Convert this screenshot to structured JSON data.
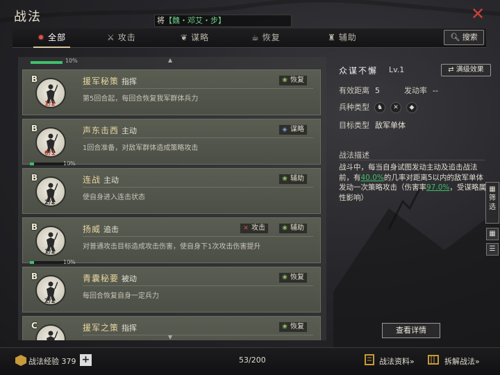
{
  "header": {
    "title": "战法",
    "general_prefix": "将",
    "general_name": "【魏・邓艾・步】",
    "close_icon": "close-icon"
  },
  "tabs": [
    {
      "label": "全部",
      "icon": "all-icon",
      "active": true
    },
    {
      "label": "攻击",
      "icon": "swords-icon",
      "active": false
    },
    {
      "label": "谋略",
      "icon": "scheme-icon",
      "active": false
    },
    {
      "label": "恢复",
      "icon": "teapot-icon",
      "active": false
    },
    {
      "label": "辅助",
      "icon": "bag-icon",
      "active": false
    }
  ],
  "search_label": "搜索",
  "list": {
    "top_progress": "10%",
    "cards": [
      {
        "grade": "B",
        "name": "援军秘策",
        "kind": "指挥",
        "desc": "第5回合起，每回合恢复我军群体兵力",
        "stack": "1/2",
        "stack_red": true,
        "badges": [
          {
            "label": "恢复",
            "type": "g"
          }
        ],
        "progress": null
      },
      {
        "grade": "B",
        "name": "声东击西",
        "kind": "主动",
        "desc": "1回合准备，对敌军群体造成策略攻击",
        "stack": "0/1",
        "stack_red": true,
        "badges": [
          {
            "label": "谋略",
            "type": "b"
          }
        ],
        "progress": "10%"
      },
      {
        "grade": "B",
        "name": "连战",
        "kind": "主动",
        "desc": "使自身进入连击状态",
        "stack": "2/2",
        "stack_red": false,
        "badges": [
          {
            "label": "辅助",
            "type": "g"
          }
        ],
        "progress": null
      },
      {
        "grade": "B",
        "name": "扬威",
        "kind": "追击",
        "desc": "对普通攻击目标造成攻击伤害，使自身下1次攻击伤害提升",
        "stack": "1/2",
        "stack_red": false,
        "badges": [
          {
            "label": "攻击",
            "type": "r"
          },
          {
            "label": "辅助",
            "type": "g"
          }
        ],
        "progress": "10%"
      },
      {
        "grade": "B",
        "name": "青囊秘要",
        "kind": "被动",
        "desc": "每回合恢复自身一定兵力",
        "stack": "2/2",
        "stack_red": false,
        "badges": [
          {
            "label": "恢复",
            "type": "g"
          }
        ],
        "progress": null
      },
      {
        "grade": "C",
        "name": "援军之策",
        "kind": "指挥",
        "desc": "",
        "stack": "",
        "stack_red": false,
        "badges": [
          {
            "label": "恢复",
            "type": "g"
          }
        ],
        "progress": null
      }
    ]
  },
  "detail": {
    "name": "众谋不懈",
    "level": "Lv.1",
    "max_effect_label": "满级效果",
    "range_label": "有效距离",
    "range_value": "5",
    "rate_label": "发动率",
    "rate_value": "--",
    "troop_label": "兵种类型",
    "target_label": "目标类型",
    "target_value": "敌军单体",
    "section_label": "战法描述",
    "desc_parts": [
      "战斗中，每当自身试图发动主动及追击战法前，有",
      "40.0%",
      "的几率对距离5以内的敌军单体发动一次策略攻击（伤害率",
      "97.0%",
      "，受谋略属性影响）"
    ],
    "view_detail_label": "查看详情"
  },
  "side": {
    "filter_label": "筛选"
  },
  "bottom": {
    "exp_label": "战法经验",
    "exp_value": "379",
    "count": "53/200",
    "info_link": "战法资料»",
    "dismantle_link": "拆解战法»"
  },
  "colors": {
    "accent_red": "#d0403a",
    "highlight_green": "#3fbf6a",
    "name_gold": "#e8d7a0"
  }
}
